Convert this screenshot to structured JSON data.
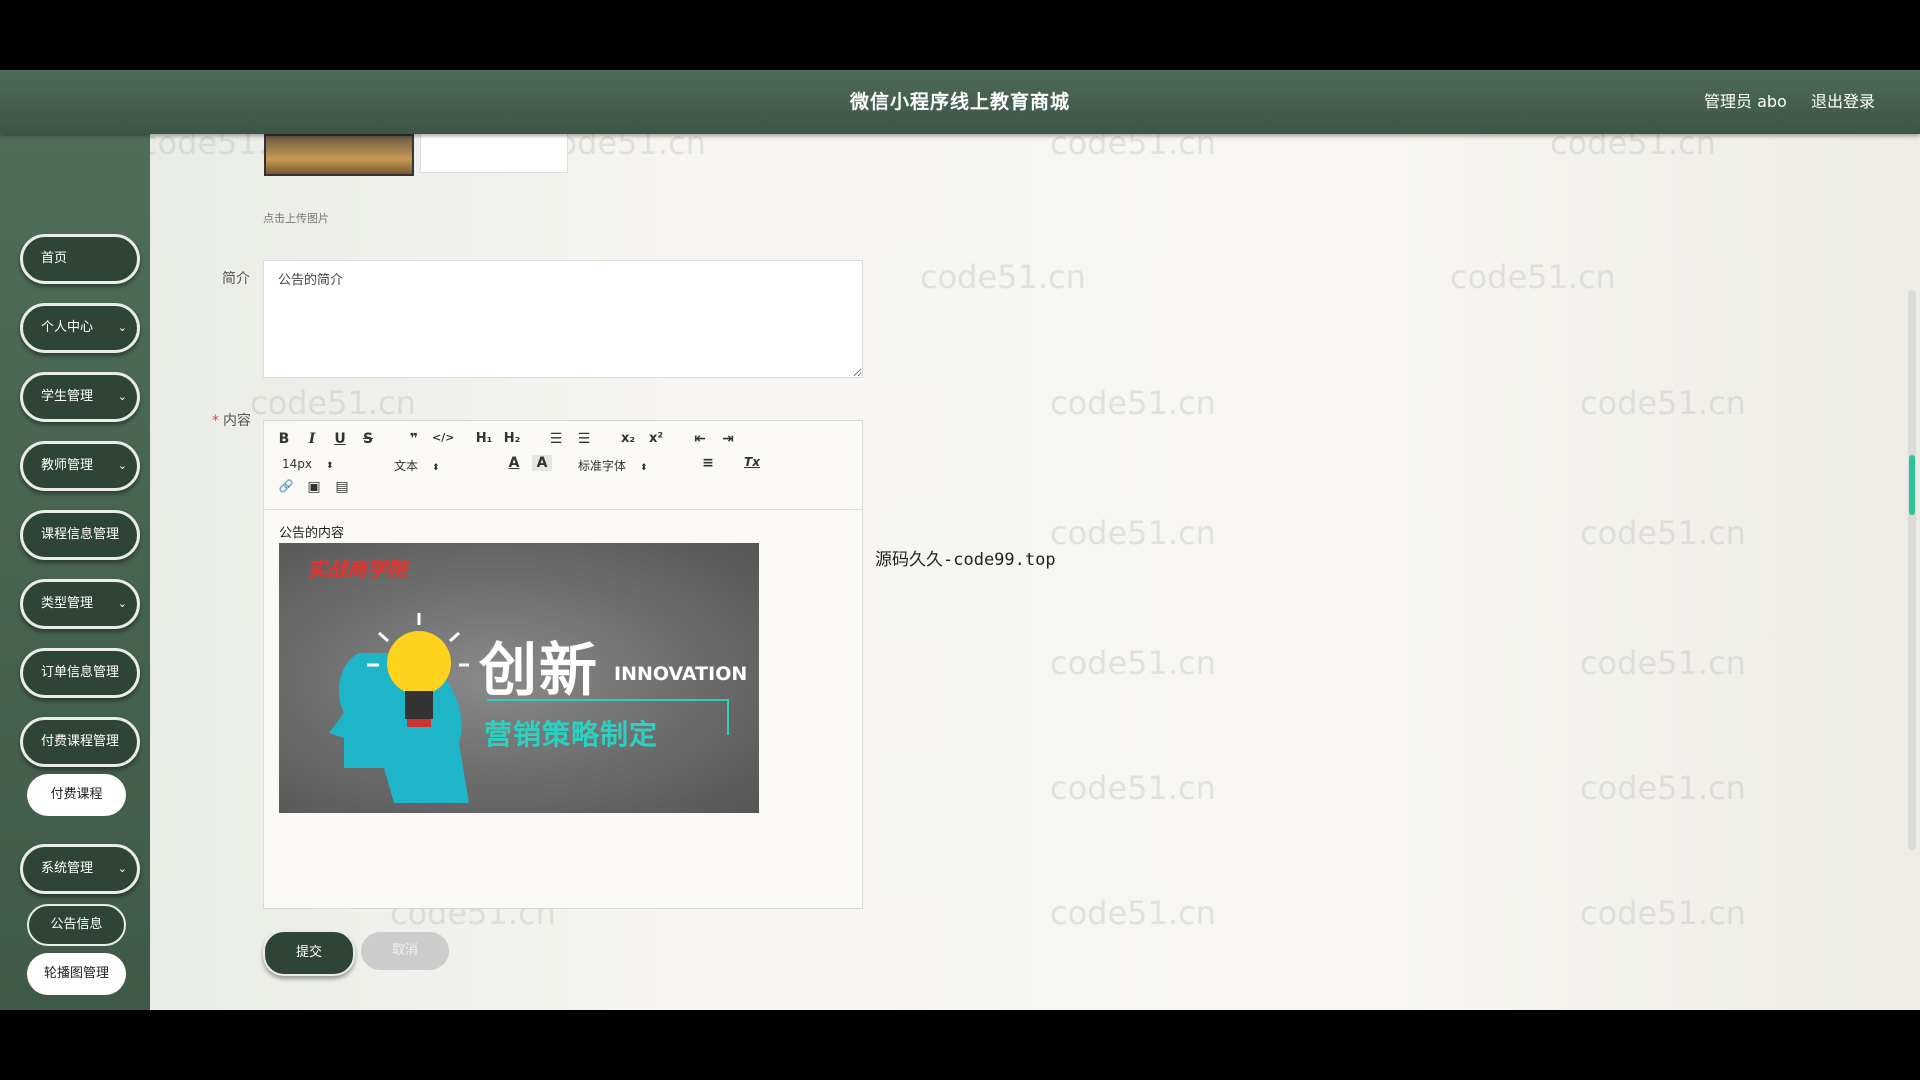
{
  "header": {
    "title": "微信小程序线上教育商城",
    "admin_label": "管理员 abo",
    "logout_label": "退出登录"
  },
  "sidebar": {
    "items": [
      {
        "label": "首页",
        "expandable": false
      },
      {
        "label": "个人中心",
        "expandable": true
      },
      {
        "label": "学生管理",
        "expandable": true
      },
      {
        "label": "教师管理",
        "expandable": true
      },
      {
        "label": "课程信息管理",
        "expandable": true
      },
      {
        "label": "类型管理",
        "expandable": true
      },
      {
        "label": "订单信息管理",
        "expandable": true
      },
      {
        "label": "付费课程管理",
        "expandable": true
      },
      {
        "label": "付费课程",
        "sub": true
      },
      {
        "label": "系统管理",
        "expandable": true
      },
      {
        "label": "公告信息",
        "sub": true
      },
      {
        "label": "轮播图管理",
        "sub": true
      }
    ]
  },
  "form": {
    "upload_hint": "点击上传图片",
    "intro_label": "简介",
    "intro_value": "公告的简介",
    "content_label": "内容",
    "content_required": "*",
    "content_text": "公告的内容",
    "submit_label": "提交",
    "cancel_label": "取消"
  },
  "editor": {
    "toolbar": {
      "bold": "B",
      "italic": "I",
      "underline": "U",
      "strike": "S",
      "quote": "❞",
      "code": "</>",
      "h1": "H₁",
      "h2": "H₂",
      "ol": "☰",
      "ul": "☰",
      "sub": "x₂",
      "sup": "x²",
      "outdent": "⇤",
      "indent": "⇥",
      "size_value": "14px",
      "format_value": "文本",
      "font_value": "标准字体",
      "color": "A",
      "bg_color": "A",
      "align": "≡",
      "clear": "Tx",
      "link": "🔗",
      "image": "▣",
      "video": "▤"
    },
    "banner": {
      "college": "实战商学院",
      "big_text": "创新",
      "eng_text": "INNOVATION",
      "sub_text": "营销策略制定"
    }
  },
  "side_note": "源码久久-code99.top",
  "watermark_text": "code51.cn"
}
